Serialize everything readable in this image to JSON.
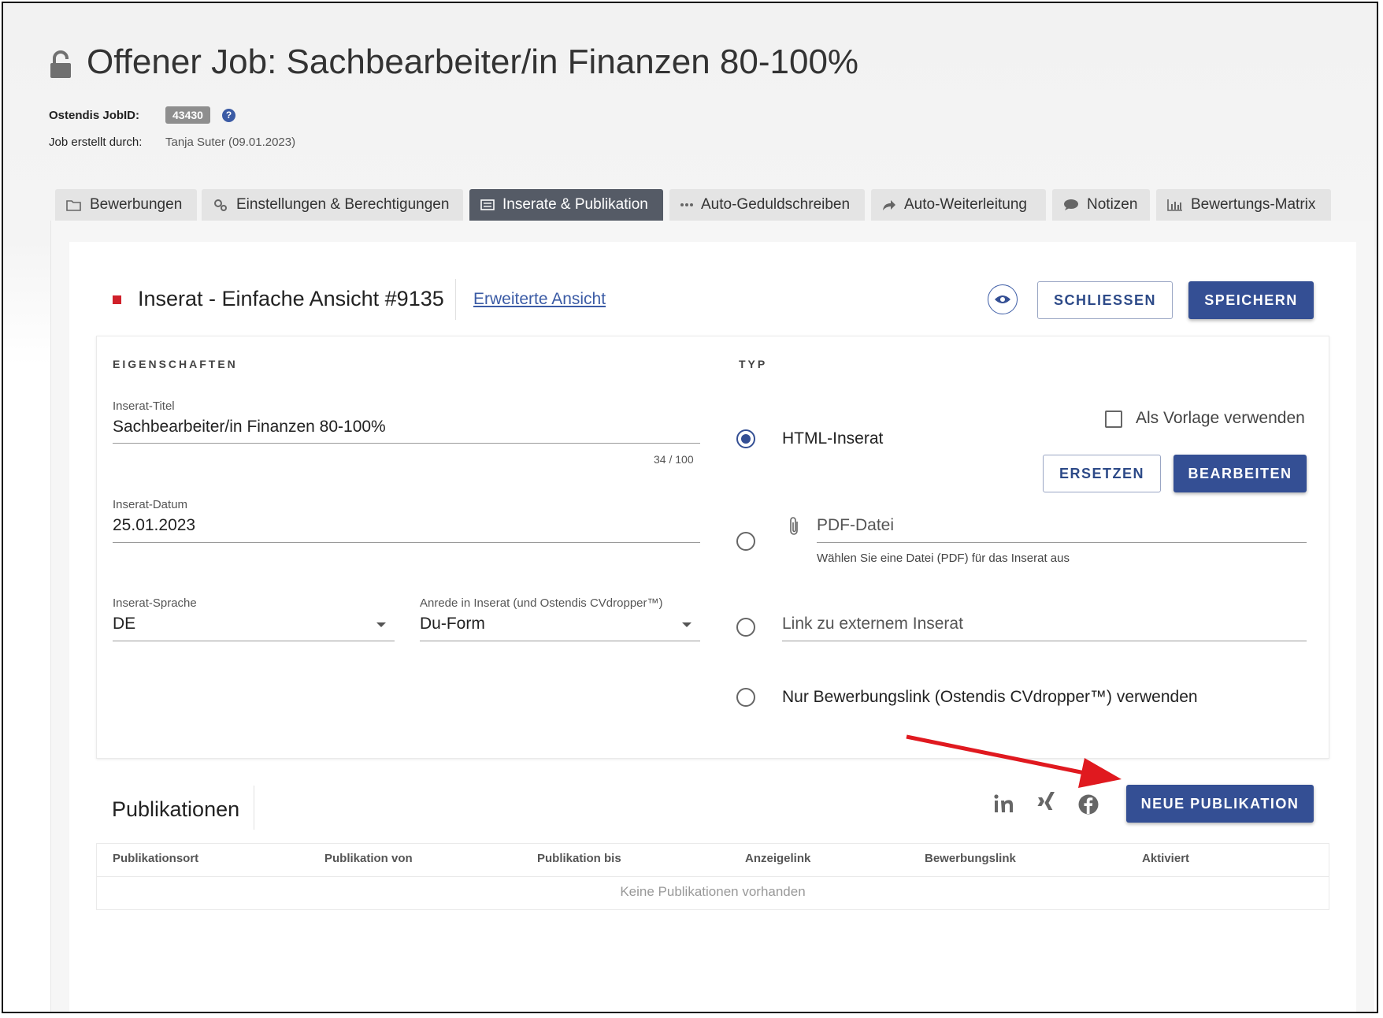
{
  "header": {
    "title": "Offener Job: Sachbearbeiter/in Finanzen 80-100%",
    "jobid_label": "Ostendis JobID:",
    "jobid_value": "43430",
    "help_glyph": "?",
    "created_label": "Job erstellt durch:",
    "created_value": "Tanja Suter (09.01.2023)"
  },
  "tabs": [
    {
      "label": "Bewerbungen",
      "icon": "folder-icon"
    },
    {
      "label": "Einstellungen & Berechtigungen",
      "icon": "gears-icon"
    },
    {
      "label": "Inserate & Publikation",
      "icon": "list-icon",
      "active": true
    },
    {
      "label": "Auto-Geduldschreiben",
      "icon": "dots-icon"
    },
    {
      "label": "Auto-Weiterleitung",
      "icon": "share-arrow-icon"
    },
    {
      "label": "Notizen",
      "icon": "comment-icon"
    },
    {
      "label": "Bewertungs-Matrix",
      "icon": "bar-chart-icon"
    }
  ],
  "inserat": {
    "title": "Inserat - Einfache Ansicht #9135",
    "extended_link": "Erweiterte Ansicht",
    "close_button": "SCHLIESSEN",
    "save_button": "SPEICHERN"
  },
  "properties": {
    "heading": "EIGENSCHAFTEN",
    "title_label": "Inserat-Titel",
    "title_value": "Sachbearbeiter/in Finanzen 80-100%",
    "title_counter": "34 / 100",
    "date_label": "Inserat-Datum",
    "date_value": "25.01.2023",
    "language_label": "Inserat-Sprache",
    "language_value": "DE",
    "salutation_label": "Anrede in Inserat (und Ostendis CVdropper™)",
    "salutation_value": "Du-Form"
  },
  "type": {
    "heading": "TYP",
    "template_checkbox": "Als Vorlage verwenden",
    "html_option": "HTML-Inserat",
    "replace_button": "ERSETZEN",
    "edit_button": "BEARBEITEN",
    "pdf_placeholder": "PDF-Datei",
    "pdf_hint": "Wählen Sie eine Datei (PDF) für das Inserat aus",
    "link_placeholder": "Link zu externem Inserat",
    "cvdropper_option": "Nur Bewerbungslink (Ostendis CVdropper™) verwenden",
    "selected": "html"
  },
  "publications": {
    "title": "Publikationen",
    "new_button": "NEUE PUBLIKATION",
    "social": [
      "linkedin-icon",
      "xing-icon",
      "facebook-icon"
    ],
    "columns": [
      "Publikationsort",
      "Publikation von",
      "Publikation bis",
      "Anzeigelink",
      "Bewerbungslink",
      "Aktiviert"
    ],
    "empty_text": "Keine Publikationen vorhanden"
  },
  "colors": {
    "primary": "#344f94",
    "accent_red": "#d0202a",
    "annotation_arrow": "#e0191f"
  }
}
